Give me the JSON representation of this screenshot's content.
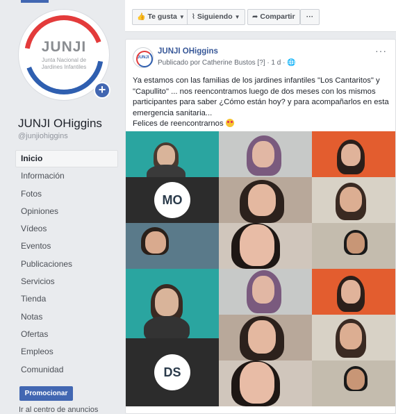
{
  "page": {
    "name": "JUNJI OHiggins",
    "handle": "@junjiohiggins",
    "logo": {
      "word": "JUNJI",
      "subtitle": "Junta Nacional de Jardines Infantiles"
    }
  },
  "nav": {
    "items": [
      {
        "label": "Inicio",
        "active": true
      },
      {
        "label": "Información"
      },
      {
        "label": "Fotos"
      },
      {
        "label": "Opiniones"
      },
      {
        "label": "Vídeos"
      },
      {
        "label": "Eventos"
      },
      {
        "label": "Publicaciones"
      },
      {
        "label": "Servicios"
      },
      {
        "label": "Tienda"
      },
      {
        "label": "Notas"
      },
      {
        "label": "Ofertas"
      },
      {
        "label": "Empleos"
      },
      {
        "label": "Comunidad"
      }
    ],
    "promote_label": "Promocionar",
    "ads_link": "Ir al centro de anuncios"
  },
  "actions": {
    "like": "Te gusta",
    "following": "Siguiendo",
    "share": "Compartir",
    "more": "···"
  },
  "post": {
    "author": "JUNJI OHiggins",
    "meta": "Publicado por Catherine Bustos [?] · 1 d ·",
    "avatar_text": "JUNJI",
    "more": "···",
    "text_lines": [
      "Ya estamos con las familias de los jardines infantiles \"Los Cantaritos\" y",
      "\"Capullito\" ... nos reencontramos luego de dos meses con los mismos",
      "participantes para saber ¿Cómo están hoy? y para acompañarlos en esta",
      "emergencia sanitaria...",
      "Felices de reencontrarnos"
    ],
    "emoji": "smiling-face-with-heart-eyes",
    "video_tiles": [
      {
        "initials": ""
      },
      {
        "initials": ""
      },
      {
        "initials": ""
      },
      {
        "initials": "MO"
      },
      {
        "initials": ""
      },
      {
        "initials": ""
      },
      {
        "initials": ""
      },
      {
        "initials": ""
      },
      {
        "initials": ""
      },
      {
        "initials": ""
      },
      {
        "initials": ""
      },
      {
        "initials": ""
      },
      {
        "initials": ""
      },
      {
        "initials": "DS"
      },
      {
        "initials": ""
      },
      {
        "initials": ""
      }
    ]
  },
  "colors": {
    "brand_blue": "#4267b2",
    "link_blue": "#385898",
    "logo_red": "#e33b3b",
    "logo_blue": "#2f5fb0",
    "background": "#e9ebee"
  }
}
